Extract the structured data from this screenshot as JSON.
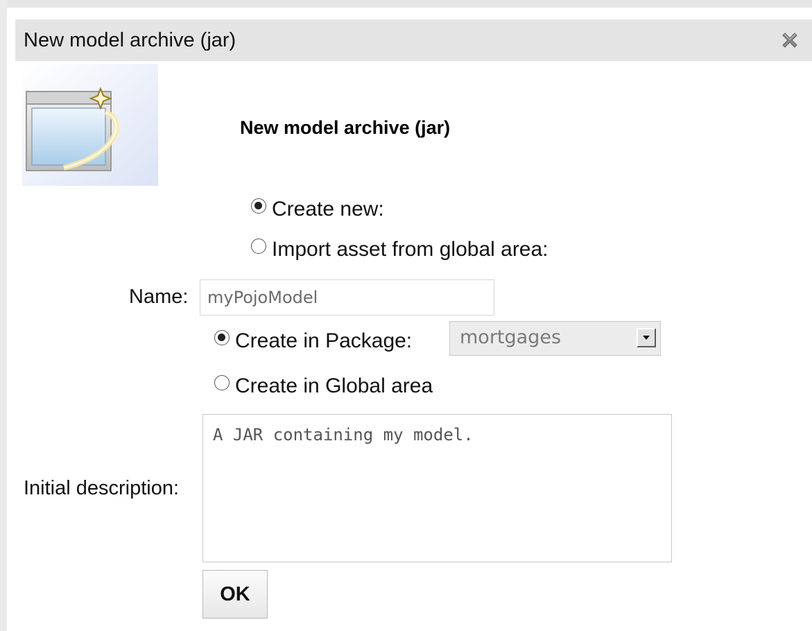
{
  "window": {
    "title": "New model archive (jar)",
    "close_icon": "close-icon"
  },
  "header": {
    "icon": "new-window-wizard-icon",
    "title": "New model archive (jar)"
  },
  "source_options": {
    "create_new": {
      "label": "Create new:",
      "checked": true
    },
    "import_global": {
      "label": "Import asset from global area:",
      "checked": false
    }
  },
  "name": {
    "label": "Name:",
    "value": "myPojoModel"
  },
  "location_options": {
    "create_in_package": {
      "label": "Create in Package:",
      "checked": true
    },
    "package_select": {
      "value": "mortgages"
    },
    "create_in_global": {
      "label": "Create in Global area",
      "checked": false
    }
  },
  "description": {
    "label": "Initial description:",
    "value": "A JAR containing my model."
  },
  "actions": {
    "ok_label": "OK"
  },
  "colors": {
    "titlebar": "#e4e4e4",
    "background": "#ffffff"
  }
}
